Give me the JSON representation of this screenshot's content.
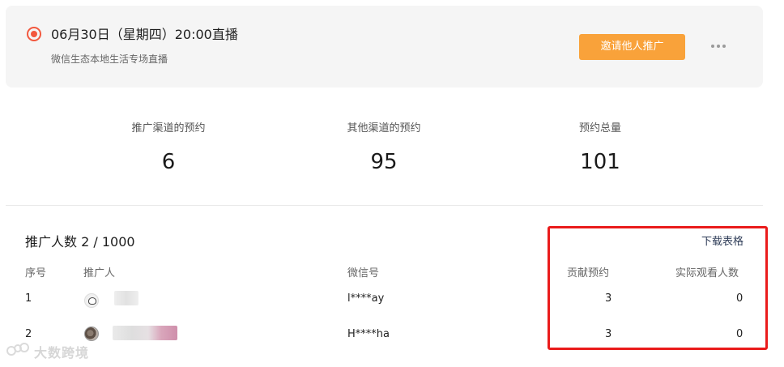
{
  "live": {
    "title": "06月30日（星期四）20:00直播",
    "subtitle": "微信生态本地生活专场直播",
    "invite_button": "邀请他人推广"
  },
  "stats": [
    {
      "label": "推广渠道的预约",
      "value": "6"
    },
    {
      "label": "其他渠道的预约",
      "value": "95"
    },
    {
      "label": "预约总量",
      "value": "101"
    }
  ],
  "promoters": {
    "count_title": "推广人数 2 / 1000",
    "download_link": "下载表格",
    "columns": {
      "index": "序号",
      "promoter": "推广人",
      "wechat": "微信号",
      "contributed": "贡献预约",
      "viewers": "实际观看人数"
    },
    "rows": [
      {
        "index": "1",
        "wechat": "l****ay",
        "contributed": "3",
        "viewers": "0"
      },
      {
        "index": "2",
        "wechat": "H****ha",
        "contributed": "3",
        "viewers": "0"
      }
    ]
  },
  "watermark": {
    "text": "大数跨境"
  },
  "colors": {
    "accent_orange": "#f9a23a",
    "live_red": "#f2583e",
    "highlight_red": "#ea1b1b",
    "card_bg": "#f5f5f5"
  },
  "icons": [
    "live-radio-icon",
    "more-dots-icon",
    "avatar-icon",
    "watermark-logo-icon"
  ]
}
